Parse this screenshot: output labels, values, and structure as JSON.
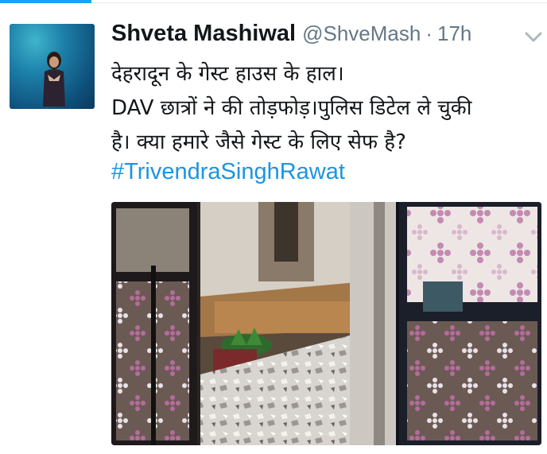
{
  "tweet": {
    "author_name": "Shveta Mashiwal",
    "handle": "@ShveMash",
    "separator": "·",
    "time": "17h",
    "text_lines": [
      "देहरादून के गेस्ट हाउस के हाल।",
      "DAV छात्रों ने की तोड़फोड़।पुलिस डिटेल ले चुकी",
      "है। क्या हमारे जैसे गेस्ट के लिए सेफ है?"
    ],
    "hashtag": "#TrivendraSinghRawat"
  },
  "colors": {
    "accent": "#1da1f2",
    "hashtag": "#1b95e0",
    "secondary_text": "#657786",
    "primary_text": "#14171a"
  },
  "icons": {
    "menu": "chevron-down-icon"
  }
}
